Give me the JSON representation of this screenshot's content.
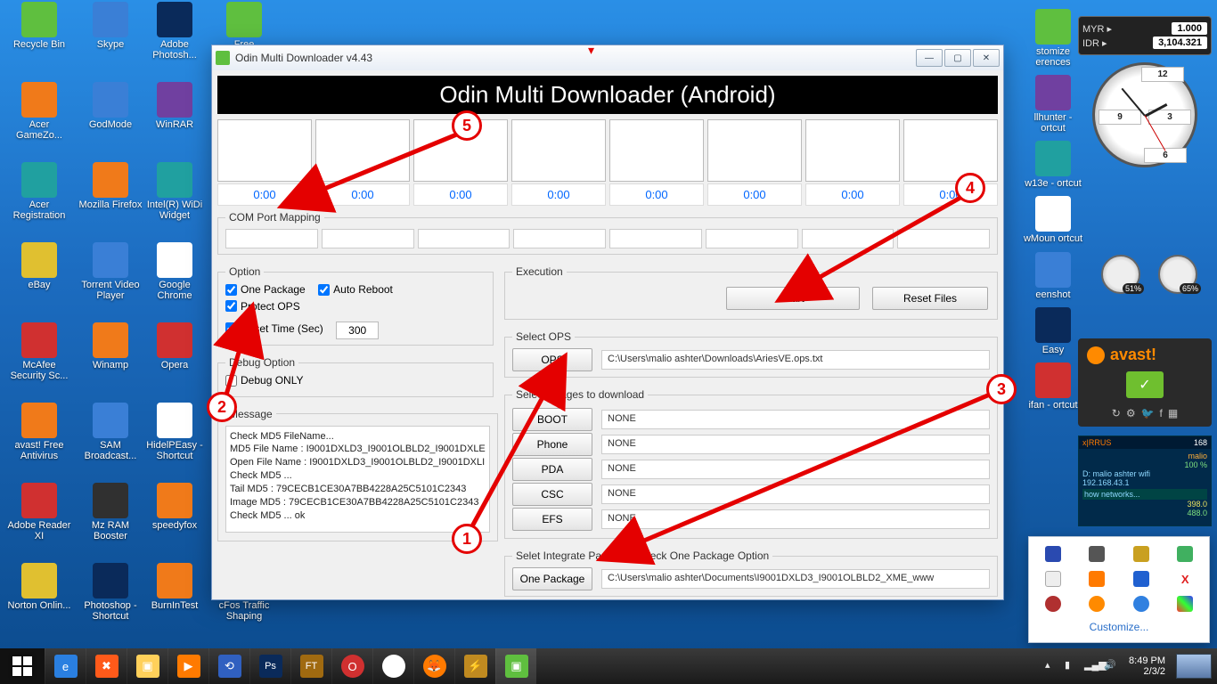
{
  "window": {
    "title": "Odin Multi Downloader v4.43",
    "banner": "Odin Multi Downloader (Android)"
  },
  "timers": [
    "0:00",
    "0:00",
    "0:00",
    "0:00",
    "0:00",
    "0:00",
    "0:00",
    "0:00"
  ],
  "com_port_label": "COM Port Mapping",
  "option": {
    "legend": "Option",
    "one_package": "One Package",
    "auto_reboot": "Auto Reboot",
    "protect_ops": "Protect OPS",
    "reset_time_label": "Reset Time (Sec)",
    "reset_time_value": "300"
  },
  "debug": {
    "legend": "Debug Option",
    "debug_only": "Debug ONLY"
  },
  "message": {
    "legend": "Message",
    "text": "Check MD5 FileName...\nMD5 File Name : I9001DXLD3_I9001OLBLD2_I9001DXLE\nOpen File Name : I9001DXLD3_I9001OLBLD2_I9001DXLI\nCheck MD5 ...\nTail MD5 : 79CECB1CE30A7BB4228A25C5101C2343\nImage MD5 : 79CECB1CE30A7BB4228A25C5101C2343\nCheck MD5 ... ok"
  },
  "execution": {
    "legend": "Execution",
    "start": "Start",
    "reset": "Reset Files"
  },
  "ops": {
    "legend": "Select OPS",
    "btn": "OPS",
    "path": "C:\\Users\\malio ashter\\Downloads\\AriesVE.ops.txt"
  },
  "images": {
    "legend": "Select Images to download",
    "rows": [
      {
        "btn": "BOOT",
        "val": "NONE"
      },
      {
        "btn": "Phone",
        "val": "NONE"
      },
      {
        "btn": "PDA",
        "val": "NONE"
      },
      {
        "btn": "CSC",
        "val": "NONE"
      },
      {
        "btn": "EFS",
        "val": "NONE"
      }
    ]
  },
  "integrate": {
    "legend": "Selet Integrate Package : check One Package Option",
    "btn": "One Package",
    "path": "C:\\Users\\malio ashter\\Documents\\I9001DXLD3_I9001OLBLD2_XME_www"
  },
  "desktop_icons": [
    [
      "Recycle Bin",
      "bg-green",
      "8",
      "2"
    ],
    [
      "Skype",
      "bg-blue",
      "88",
      "2"
    ],
    [
      "Adobe Photosh...",
      "bg-navy",
      "160",
      "2"
    ],
    [
      "Acer GameZo...",
      "bg-orange",
      "8",
      "92"
    ],
    [
      "GodMode",
      "bg-blue",
      "88",
      "92"
    ],
    [
      "WinRAR",
      "bg-purple",
      "160",
      "92"
    ],
    [
      "Acer Registration",
      "bg-teal",
      "8",
      "182"
    ],
    [
      "Mozilla Firefox",
      "bg-orange",
      "88",
      "182"
    ],
    [
      "Intel(R) WiDi Widget",
      "bg-teal",
      "160",
      "182"
    ],
    [
      "eBay",
      "bg-yellow",
      "8",
      "272"
    ],
    [
      "Torrent Video Player",
      "bg-blue",
      "88",
      "272"
    ],
    [
      "Google Chrome",
      "bg-white",
      "160",
      "272"
    ],
    [
      "McAfee Security Sc...",
      "bg-red",
      "8",
      "362"
    ],
    [
      "Winamp",
      "bg-orange",
      "88",
      "362"
    ],
    [
      "Opera",
      "bg-red",
      "160",
      "362"
    ],
    [
      "avast! Free Antivirus",
      "bg-orange",
      "8",
      "452"
    ],
    [
      "SAM Broadcast...",
      "bg-blue",
      "88",
      "452"
    ],
    [
      "HidelPEasy - Shortcut",
      "bg-white",
      "160",
      "452"
    ],
    [
      "Adobe Reader XI",
      "bg-red",
      "8",
      "542"
    ],
    [
      "Mz RAM Booster",
      "bg-dark",
      "88",
      "542"
    ],
    [
      "speedyfox",
      "bg-orange",
      "160",
      "542"
    ],
    [
      "Norton Onlin...",
      "bg-yellow",
      "8",
      "632"
    ],
    [
      "Photoshop - Shortcut",
      "bg-navy",
      "88",
      "632"
    ],
    [
      "BurnInTest",
      "bg-orange",
      "160",
      "632"
    ],
    [
      "Free Download...",
      "bg-green",
      "238",
      "2"
    ],
    [
      "cFos Traffic Shaping",
      "bg-teal",
      "238",
      "632"
    ]
  ],
  "right_icons": [
    [
      "stomize erences",
      "bg-green"
    ],
    [
      "llhunter - ortcut",
      "bg-purple"
    ],
    [
      "w13e - ortcut",
      "bg-teal"
    ],
    [
      "wMoun ortcut",
      "bg-white"
    ],
    [
      "eenshot",
      "bg-blue"
    ],
    [
      "Easy",
      "bg-navy"
    ],
    [
      "ifan - ortcut",
      "bg-red"
    ]
  ],
  "currency": {
    "rows": [
      {
        "code": "MYR ▸",
        "val": "1.000"
      },
      {
        "code": "IDR ▸",
        "val": "3,104.321"
      }
    ]
  },
  "meters": [
    "51%",
    "65%"
  ],
  "clock": "8:49 PM",
  "date": "2/3/2",
  "customize": "Customize...",
  "annotations": [
    "1",
    "2",
    "3",
    "4",
    "5"
  ],
  "avast": "avast!",
  "xirrus": {
    "title": "x|RRUS",
    "ssid": "D:  malio ashter wifi",
    "ip": "192.168.43.1",
    "link": "how networks...",
    "sig": "malio",
    "pct": "100 %",
    "a": "398.0",
    "b": "488.0",
    "c": "168"
  }
}
